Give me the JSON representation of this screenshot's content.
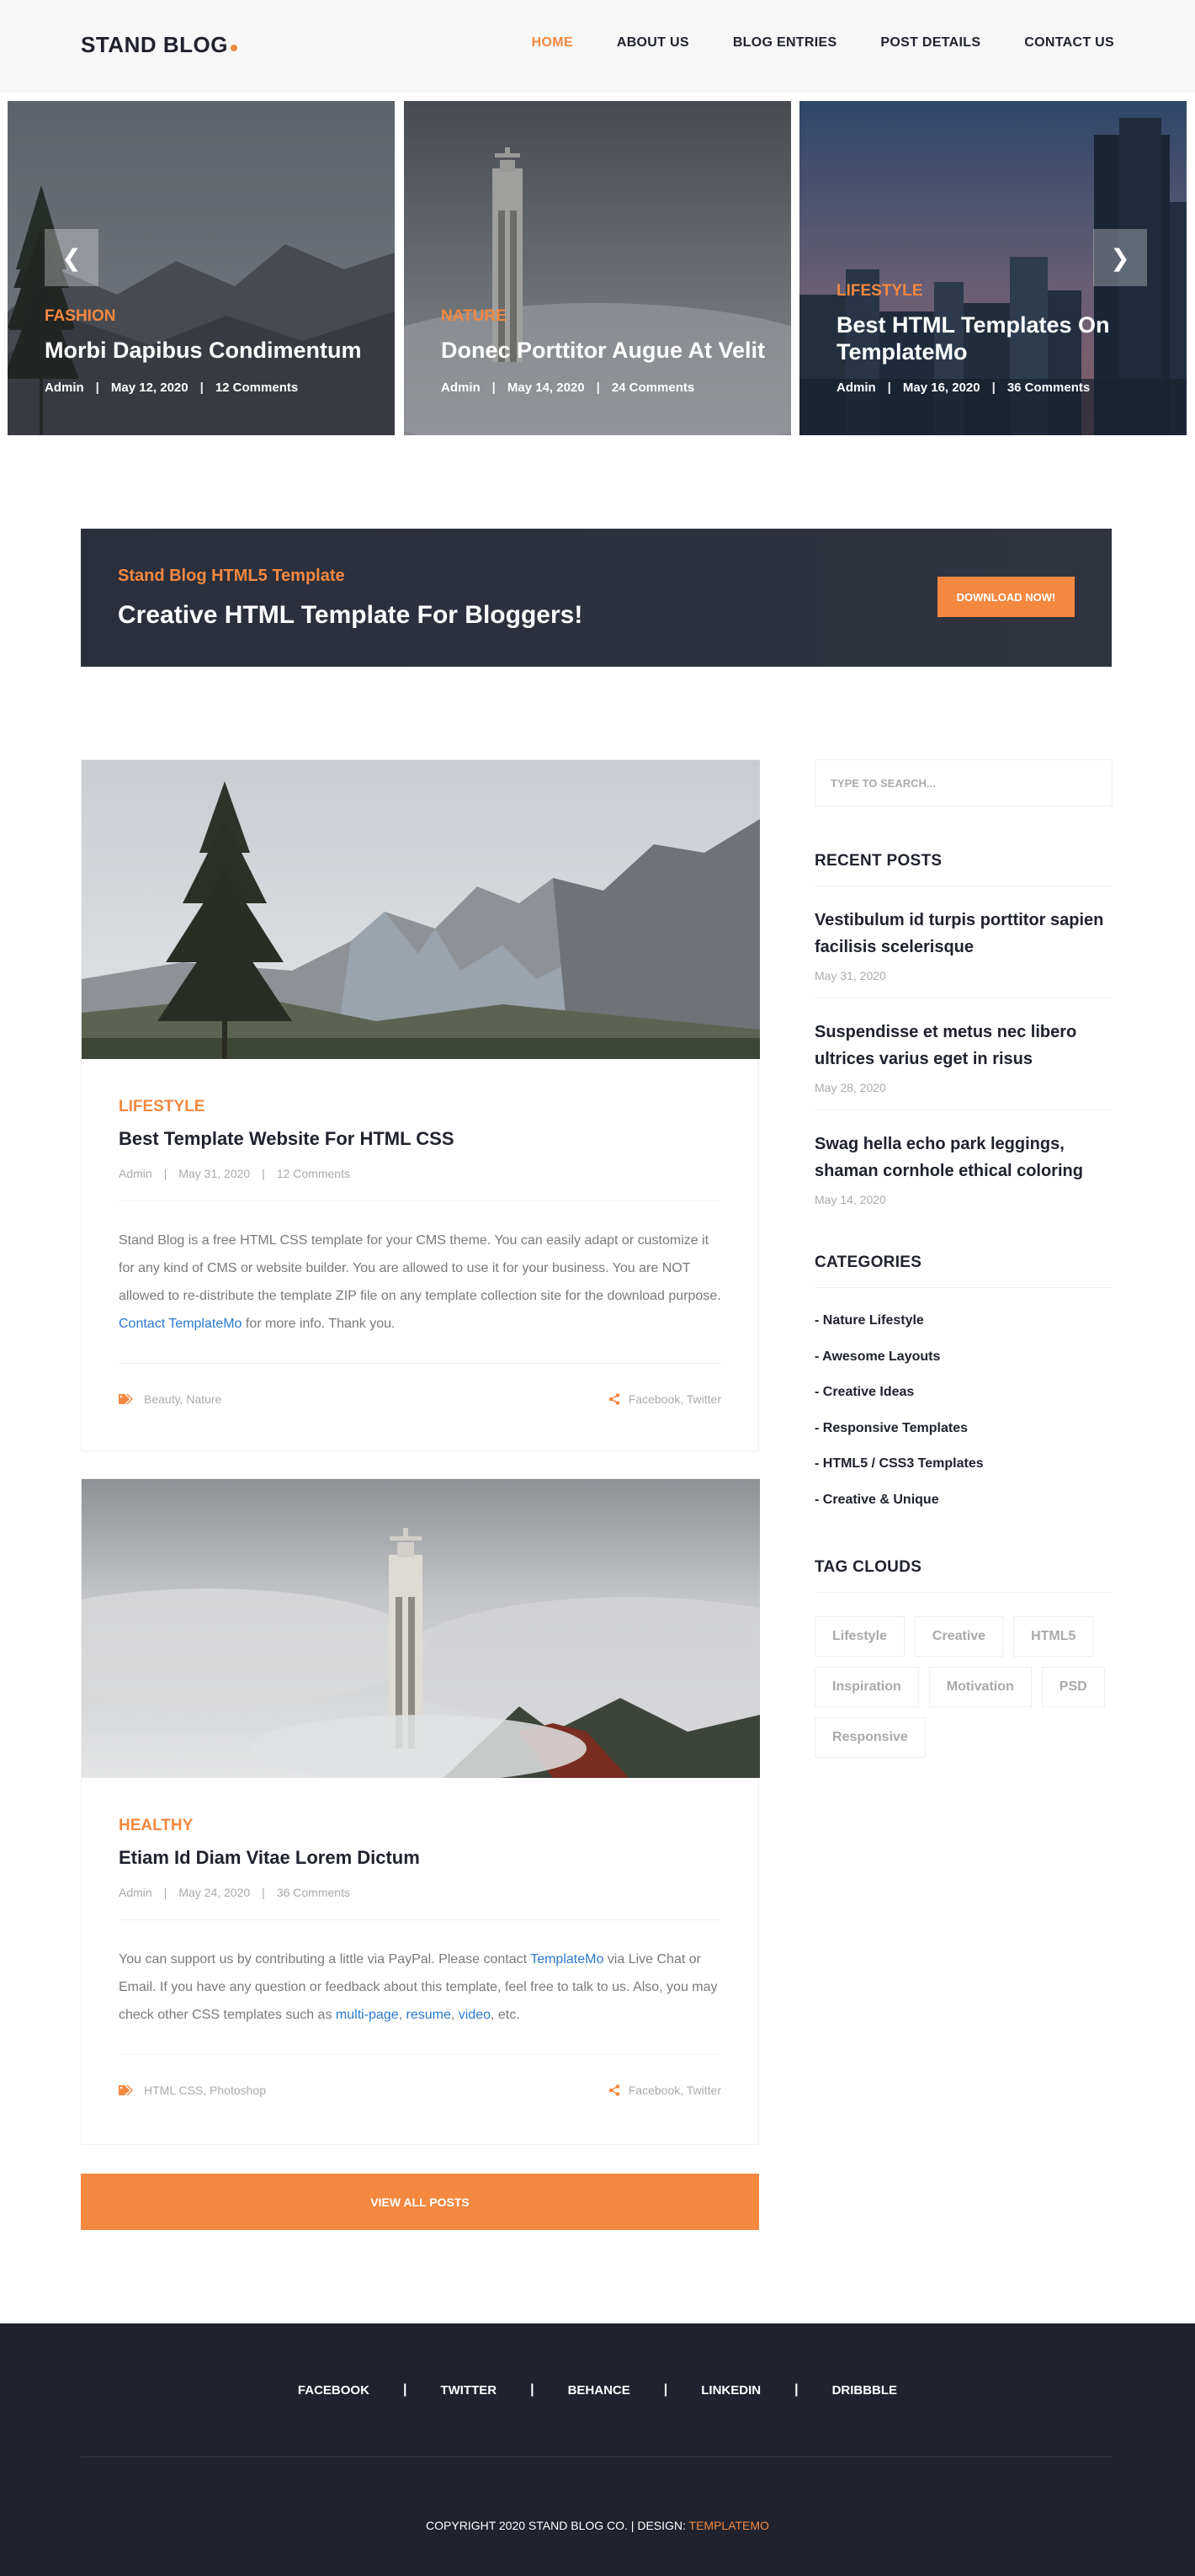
{
  "header": {
    "logo": "STAND BLOG",
    "nav": [
      "HOME",
      "ABOUT US",
      "BLOG ENTRIES",
      "POST DETAILS",
      "CONTACT US"
    ]
  },
  "slides": [
    {
      "category": "FASHION",
      "title": "Morbi Dapibus Condimentum",
      "author": "Admin",
      "date": "May 12, 2020",
      "comments": "12 Comments"
    },
    {
      "category": "NATURE",
      "title": "Donec Porttitor Augue At Velit",
      "author": "Admin",
      "date": "May 14, 2020",
      "comments": "24 Comments"
    },
    {
      "category": "LIFESTYLE",
      "title": "Best HTML Templates On TemplateMo",
      "author": "Admin",
      "date": "May 16, 2020",
      "comments": "36 Comments"
    }
  ],
  "arrows": {
    "prev": "❮",
    "next": "❯"
  },
  "cta": {
    "subtitle": "Stand Blog HTML5 Template",
    "heading": "Creative HTML Template For Bloggers!",
    "button": "DOWNLOAD NOW!"
  },
  "posts": [
    {
      "category": "LIFESTYLE",
      "title": "Best Template Website For HTML CSS",
      "author": "Admin",
      "date": "May 31, 2020",
      "comments": "12 Comments",
      "text_a": "Stand Blog is a free HTML CSS template for your CMS theme. You can easily adapt or customize it for any kind of CMS or website builder. You are allowed to use it for your business. You are NOT allowed to re-distribute the template ZIP file on any template collection site for the download purpose. ",
      "link_a": "Contact TemplateMo",
      "text_b": " for more info. Thank you.",
      "tags": "Beauty, Nature",
      "share": "Facebook, Twitter"
    },
    {
      "category": "HEALTHY",
      "title": "Etiam Id Diam Vitae Lorem Dictum",
      "author": "Admin",
      "date": "May 24, 2020",
      "comments": "36 Comments",
      "text_a": "You can support us by contributing a little via PayPal. Please contact ",
      "link_a": "TemplateMo",
      "text_b": " via Live Chat or Email. If you have any question or feedback about this template, feel free to talk to us. Also, you may check other CSS templates such as ",
      "link_b": "multi-page",
      "link_c": "resume",
      "link_d": "video",
      "text_c": ", etc.",
      "tags": "HTML CSS, Photoshop",
      "share": "Facebook, Twitter"
    }
  ],
  "view_all": "VIEW ALL POSTS",
  "sidebar": {
    "search_placeholder": "TYPE TO SEARCH...",
    "recent_heading": "RECENT POSTS",
    "recent": [
      {
        "title": "Vestibulum id turpis porttitor sapien facilisis scelerisque",
        "date": "May 31, 2020"
      },
      {
        "title": "Suspendisse et metus nec libero ultrices varius eget in risus",
        "date": "May 28, 2020"
      },
      {
        "title": "Swag hella echo park leggings, shaman cornhole ethical coloring",
        "date": "May 14, 2020"
      }
    ],
    "categories_heading": "CATEGORIES",
    "categories": [
      "- Nature Lifestyle",
      "- Awesome Layouts",
      "- Creative Ideas",
      "- Responsive Templates",
      "- HTML5 / CSS3 Templates",
      "- Creative & Unique"
    ],
    "tags_heading": "TAG CLOUDS",
    "tags": [
      "Lifestyle",
      "Creative",
      "HTML5",
      "Inspiration",
      "Motivation",
      "PSD",
      "Responsive"
    ]
  },
  "footer": {
    "social": [
      "FACEBOOK",
      "TWITTER",
      "BEHANCE",
      "LINKEDIN",
      "DRIBBBLE"
    ],
    "separator": "|",
    "copyright": "COPYRIGHT 2020 STAND BLOG CO. | DESIGN: ",
    "designer": "TEMPLATEMO"
  },
  "colors": {
    "accent": "#f48840",
    "dark": "#20232e",
    "link": "#2a7ad2",
    "muted": "#aaaaaa"
  }
}
